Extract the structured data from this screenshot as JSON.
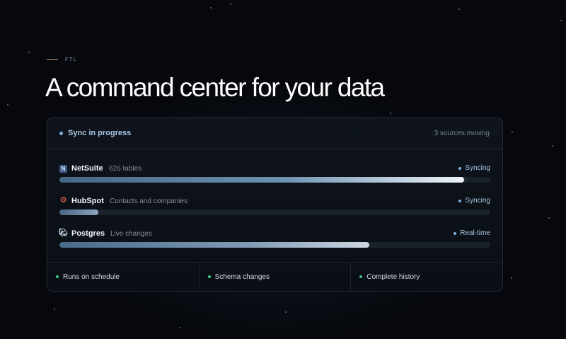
{
  "eyebrow": "FTL",
  "headline": "A command center for your data",
  "panel": {
    "title": "Sync in progress",
    "meta": "3 sources moving",
    "sources": [
      {
        "name": "NetSuite",
        "detail": "626 tables",
        "status": "Syncing",
        "progress": 0.94,
        "icon": "netsuite-icon"
      },
      {
        "name": "HubSpot",
        "detail": "Contacts and companies",
        "status": "Syncing",
        "progress": 0.09,
        "icon": "hubspot-icon"
      },
      {
        "name": "Postgres",
        "detail": "Live changes",
        "status": "Real-time",
        "progress": 0.72,
        "icon": "postgres-icon"
      }
    ],
    "features": [
      "Runs on schedule",
      "Schema changes",
      "Complete history"
    ]
  },
  "colors": {
    "accent": "#7fb2dc",
    "feature_dot": "#46c48a",
    "eyebrow_line": "#c8a05a"
  }
}
